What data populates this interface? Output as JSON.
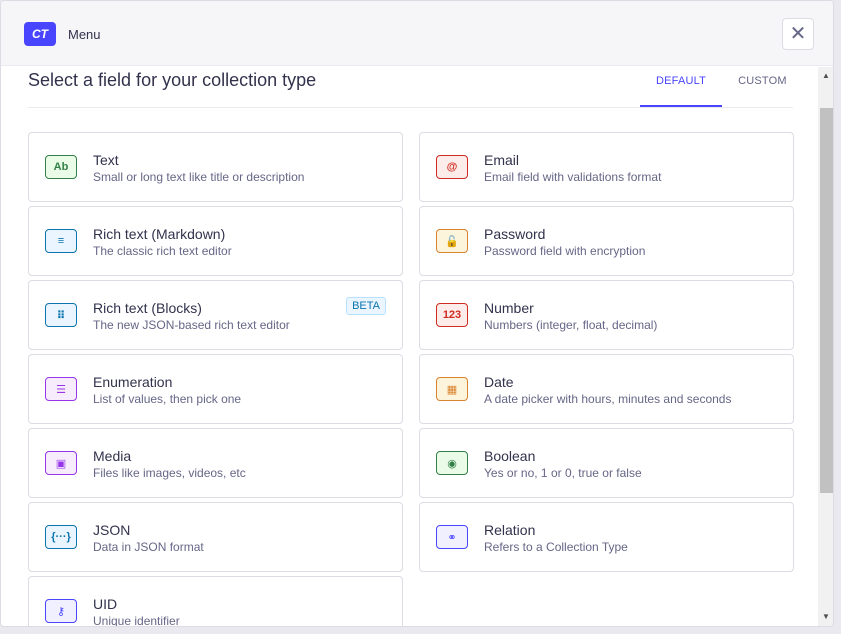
{
  "header": {
    "badge": "CT",
    "menu_label": "Menu",
    "close_glyph": "✕"
  },
  "main": {
    "title": "Select a field for your collection type",
    "tabs": [
      {
        "label": "Default",
        "active": true
      },
      {
        "label": "Custom",
        "active": false
      }
    ],
    "fields": [
      {
        "name": "Text",
        "desc": "Small or long text like title or description",
        "icon": "text-icon",
        "glyph": "Ab",
        "color": "green"
      },
      {
        "name": "Email",
        "desc": "Email field with validations format",
        "icon": "email-icon",
        "glyph": "@",
        "color": "red"
      },
      {
        "name": "Rich text (Markdown)",
        "desc": "The classic rich text editor",
        "icon": "markdown-icon",
        "glyph": "≡",
        "color": "blue"
      },
      {
        "name": "Password",
        "desc": "Password field with encryption",
        "icon": "lock-icon",
        "glyph": "🔓",
        "color": "orange"
      },
      {
        "name": "Rich text (Blocks)",
        "desc": "The new JSON-based rich text editor",
        "icon": "blocks-icon",
        "glyph": "⠿",
        "color": "blue",
        "badge": "BETA"
      },
      {
        "name": "Number",
        "desc": "Numbers (integer, float, decimal)",
        "icon": "number-icon",
        "glyph": "123",
        "color": "red"
      },
      {
        "name": "Enumeration",
        "desc": "List of values, then pick one",
        "icon": "list-icon",
        "glyph": "☰",
        "color": "purple"
      },
      {
        "name": "Date",
        "desc": "A date picker with hours, minutes and seconds",
        "icon": "calendar-icon",
        "glyph": "▦",
        "color": "orange"
      },
      {
        "name": "Media",
        "desc": "Files like images, videos, etc",
        "icon": "image-icon",
        "glyph": "▣",
        "color": "purple"
      },
      {
        "name": "Boolean",
        "desc": "Yes or no, 1 or 0, true or false",
        "icon": "toggle-icon",
        "glyph": "◉",
        "color": "green"
      },
      {
        "name": "JSON",
        "desc": "Data in JSON format",
        "icon": "json-icon",
        "glyph": "{···}",
        "color": "blue"
      },
      {
        "name": "Relation",
        "desc": "Refers to a Collection Type",
        "icon": "link-icon",
        "glyph": "⚭",
        "color": "indigo"
      },
      {
        "name": "UID",
        "desc": "Unique identifier",
        "icon": "key-icon",
        "glyph": "⚷",
        "color": "indigo"
      }
    ]
  },
  "scrollbar": {
    "up": "▲",
    "down": "▼"
  }
}
